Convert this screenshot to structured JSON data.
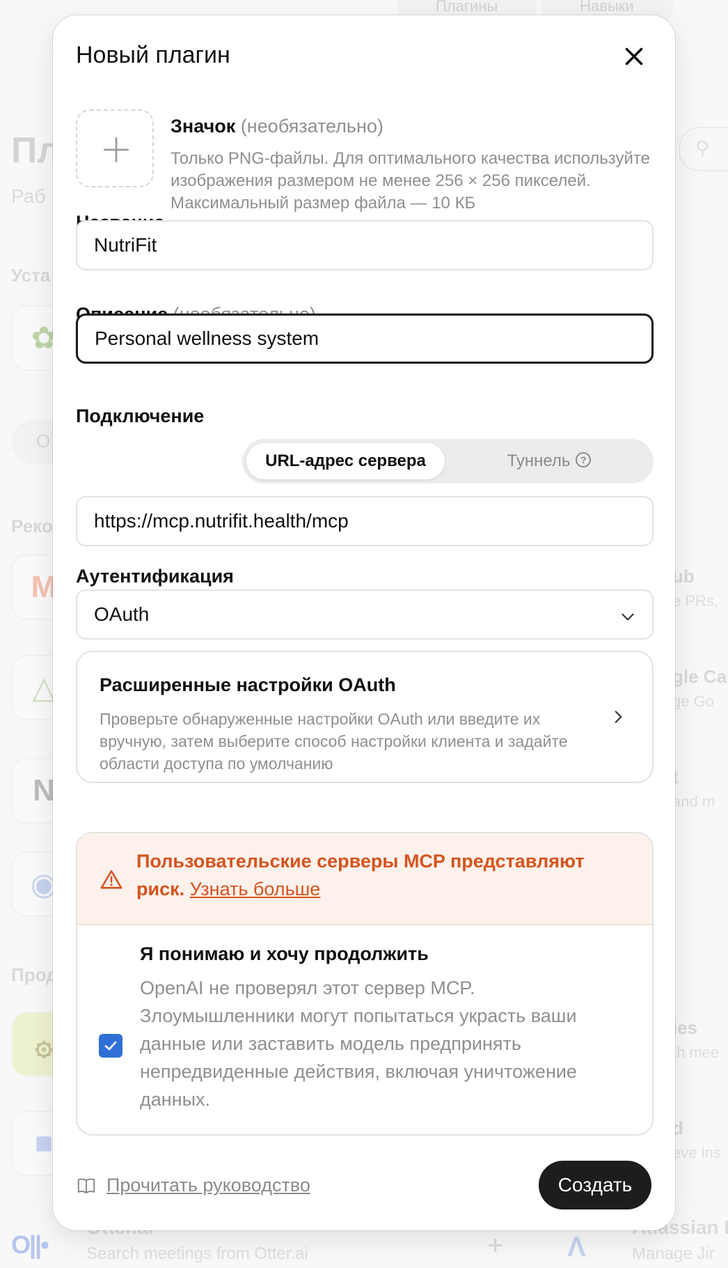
{
  "background": {
    "tabs": [
      "Плагины",
      "Навыки"
    ],
    "page_title": "Пл",
    "page_subtitle": "Раб",
    "section_installed": "Уста",
    "chip": "О",
    "section_recommended": "Реко",
    "section_popular": "Прод",
    "right_items": [
      {
        "name": "ub",
        "desc": "e PRs,"
      },
      {
        "name": "gle Cal",
        "desc": "ge Go"
      },
      {
        "name": "t",
        "desc": "and m"
      },
      {
        "name": "ies",
        "desc": "th mee"
      },
      {
        "name": "d",
        "desc": "eve ins"
      }
    ],
    "otter": {
      "name": "Otter.ai",
      "desc": "Search meetings from Otter.ai"
    },
    "atlassian": {
      "name": "Atlassian R",
      "desc": "Manage Jir"
    }
  },
  "modal": {
    "title": "Новый плагин",
    "icon": {
      "label": "Значок",
      "optional": "(необязательно)",
      "help": "Только PNG-файлы. Для оптимального качества используйте изображения размером не менее 256 × 256 пикселей. Максимальный размер файла — 10 КБ"
    },
    "name": {
      "label": "Название",
      "value": "NutriFit"
    },
    "description": {
      "label": "Описание",
      "optional": "(необязательно)",
      "value": "Personal wellness system"
    },
    "connection": {
      "label": "Подключение",
      "options": [
        "URL-адрес сервера",
        "Туннель"
      ],
      "selected": "URL-адрес сервера",
      "url_value": "https://mcp.nutrifit.health/mcp"
    },
    "auth": {
      "label": "Аутентификация",
      "value": "OAuth"
    },
    "advanced": {
      "title": "Расширенные настройки OAuth",
      "desc": "Проверьте обнаруженные настройки OAuth или введите их вручную, затем выберите способ настройки клиента и задайте области доступа по умолчанию"
    },
    "risk": {
      "warning": "Пользовательские серверы MCP представляют риск.",
      "link": "Узнать больше",
      "ack_title": "Я понимаю и хочу продолжить",
      "ack_desc": "OpenAI не проверял этот сервер MCP. Злоумышленники могут попытаться украсть ваши данные или заставить модель предпринять непредвиденные действия, включая уничтожение данных.",
      "checked": true
    },
    "footer": {
      "guide": "Прочитать руководство",
      "create": "Создать"
    }
  },
  "colors": {
    "warning": "#d4541e",
    "warning_bg": "#fdf1ec",
    "checkbox": "#2f6fd8",
    "primary_button": "#1d1d1d"
  }
}
